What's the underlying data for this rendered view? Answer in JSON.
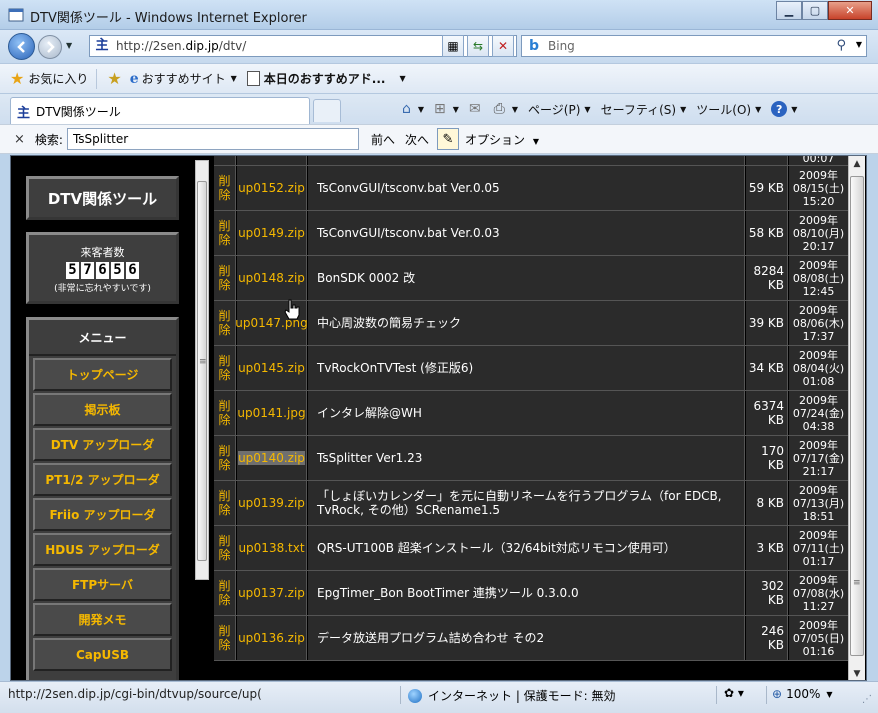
{
  "window": {
    "title": "DTV関係ツール - Windows Internet Explorer",
    "buttons": {
      "minimize": "▁",
      "maximize": "▢",
      "close": "✕"
    }
  },
  "address": {
    "url_prefix": "http://2sen.",
    "url_domain": "dip.jp",
    "url_suffix": "/dtv/",
    "search_engine": "Bing"
  },
  "favorites": {
    "favorites_label": "お気に入り",
    "suggested_label": "おすすめサイト",
    "today_label": "本日のおすすめアド..."
  },
  "tab": {
    "label": "DTV関係ツール"
  },
  "commandbar": {
    "page": "ページ(P)",
    "safety": "セーフティ(S)",
    "tools": "ツール(O)",
    "help": "?"
  },
  "find": {
    "close": "×",
    "label": "検索:",
    "value": "TsSplitter",
    "prev": "前へ",
    "next": "次へ",
    "options": "オプション"
  },
  "sidebar": {
    "site_title": "DTV関係ツール",
    "counter_label": "来客者数",
    "counter_digits": [
      "5",
      "7",
      "6",
      "5",
      "6"
    ],
    "counter_note": "(非常に忘れやすいです)",
    "menu_title": "メニュー",
    "menu_items": [
      "トップページ",
      "掲示板",
      "DTV アップローダ",
      "PT1/2 アップローダ",
      "Friio アップローダ",
      "HDUS アップローダ",
      "FTPサーバ",
      "開発メモ",
      "CapUSB"
    ]
  },
  "table": {
    "top_partial_date": "00:07",
    "rows": [
      {
        "del": "削除",
        "file": "up0152.zip",
        "desc": "TsConvGUI/tsconv.bat Ver.0.05",
        "size": "59 KB",
        "date": [
          "2009年",
          "08/15(土)",
          "15:20"
        ]
      },
      {
        "del": "削除",
        "file": "up0149.zip",
        "desc": "TsConvGUI/tsconv.bat Ver.0.03",
        "size": "58 KB",
        "date": [
          "2009年",
          "08/10(月)",
          "20:17"
        ]
      },
      {
        "del": "削除",
        "file": "up0148.zip",
        "desc": "BonSDK 0002 改",
        "size": "8284 KB",
        "date": [
          "2009年",
          "08/08(土)",
          "12:45"
        ]
      },
      {
        "del": "削除",
        "file": "up0147.png",
        "desc": "中心周波数の簡易チェック",
        "size": "39 KB",
        "date": [
          "2009年",
          "08/06(木)",
          "17:37"
        ]
      },
      {
        "del": "削除",
        "file": "up0145.zip",
        "desc": "TvRockOnTVTest (修正版6)",
        "size": "34 KB",
        "date": [
          "2009年",
          "08/04(火)",
          "01:08"
        ]
      },
      {
        "del": "削除",
        "file": "up0141.jpg",
        "desc": "インタレ解除@WH",
        "size": "6374 KB",
        "date": [
          "2009年",
          "07/24(金)",
          "04:38"
        ]
      },
      {
        "del": "削除",
        "file": "up0140.zip",
        "desc": "TsSplitter Ver1.23",
        "size": "170 KB",
        "date": [
          "2009年",
          "07/17(金)",
          "21:17"
        ]
      },
      {
        "del": "削除",
        "file": "up0139.zip",
        "desc": "「しょぼいカレンダー」を元に自動リネームを行うプログラム（for EDCB, TvRock, その他）SCRename1.5",
        "size": "8 KB",
        "date": [
          "2009年",
          "07/13(月)",
          "18:51"
        ]
      },
      {
        "del": "削除",
        "file": "up0138.txt",
        "desc": "QRS-UT100B 超楽インストール（32/64bit対応リモコン使用可）",
        "size": "3 KB",
        "date": [
          "2009年",
          "07/11(土)",
          "01:17"
        ]
      },
      {
        "del": "削除",
        "file": "up0137.zip",
        "desc": "EpgTimer_Bon BootTimer 連携ツール 0.3.0.0",
        "size": "302 KB",
        "date": [
          "2009年",
          "07/08(水)",
          "11:27"
        ]
      },
      {
        "del": "削除",
        "file": "up0136.zip",
        "desc": "データ放送用プログラム詰め合わせ その2",
        "size": "246 KB",
        "date": [
          "2009年",
          "07/05(日)",
          "01:16"
        ]
      }
    ]
  },
  "status": {
    "url": "http://2sen.dip.jp/cgi-bin/dtvup/source/up(",
    "zone": "インターネット | 保護モード: 無効",
    "zoom": "100%"
  }
}
